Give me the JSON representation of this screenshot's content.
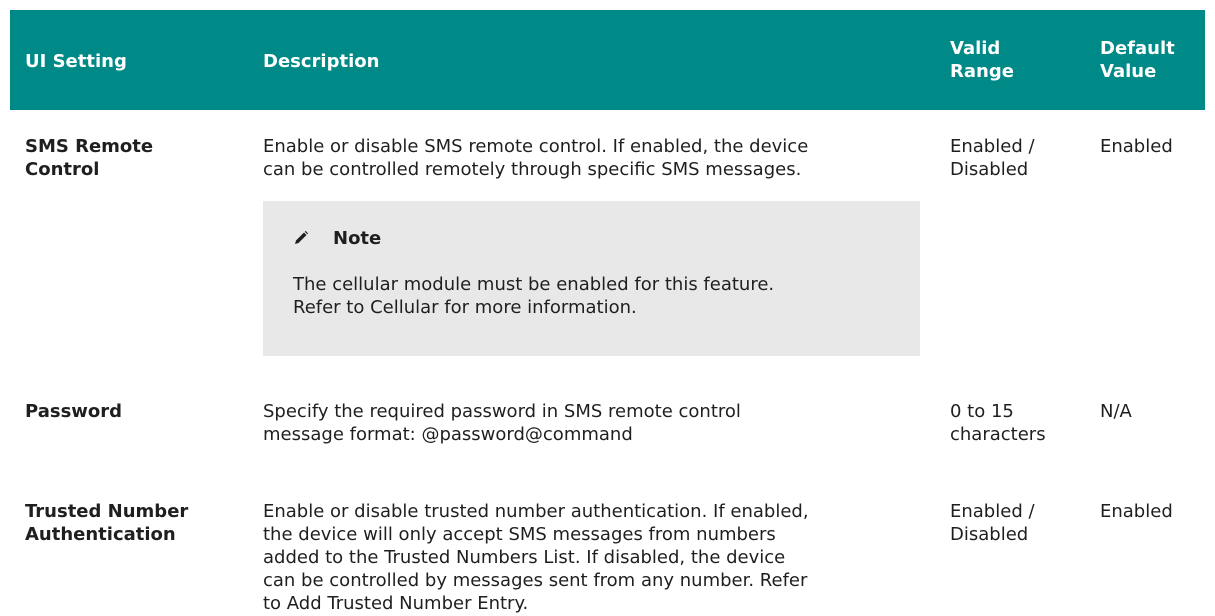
{
  "header": {
    "setting": "UI Setting",
    "description": "Description",
    "range_line1": "Valid",
    "range_line2": "Range",
    "default_line1": "Default",
    "default_line2": "Value"
  },
  "rows": [
    {
      "setting_line1": "SMS Remote",
      "setting_line2": "Control",
      "desc_line1": "Enable or disable SMS remote control. If enabled, the device",
      "desc_line2": "can be controlled remotely through specific SMS messages.",
      "range_line1": "Enabled /",
      "range_line2": "Disabled",
      "default": "Enabled",
      "note": {
        "icon": "pencil-icon",
        "title": "Note",
        "line1": "The cellular module must be enabled for this feature.",
        "line2": "Refer to Cellular for more information."
      }
    },
    {
      "setting_line1": "Password",
      "desc_line1": "Specify the required password in SMS remote control",
      "desc_line2": "message format: @password@command",
      "range_line1": "0 to 15",
      "range_line2": "characters",
      "default": "N/A"
    },
    {
      "setting_line1": "Trusted Number",
      "setting_line2": "Authentication",
      "desc_line1": "Enable or disable trusted number authentication. If enabled,",
      "desc_line2": "the device will only accept SMS messages from numbers",
      "desc_line3": "added to the Trusted Numbers List. If disabled, the device",
      "desc_line4": "can be controlled by messages sent from any number. Refer",
      "desc_line5": "to Add Trusted Number Entry.",
      "range_line1": "Enabled /",
      "range_line2": "Disabled",
      "default": "Enabled"
    }
  ],
  "colors": {
    "header_bg": "#008a87",
    "note_bg": "#e8e8e8"
  }
}
